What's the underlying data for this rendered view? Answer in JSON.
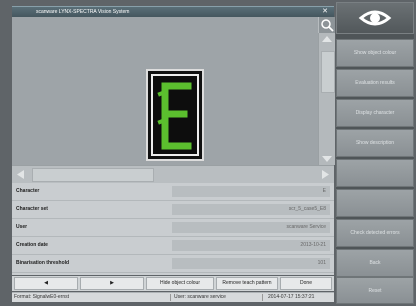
{
  "window": {
    "title": "scanware LYNX-SPECTRA Vision System",
    "close_glyph": "✕"
  },
  "viewer": {
    "zoom_icon": "search-icon",
    "character_shown": "E",
    "character_color": "#5bbf2e"
  },
  "info": {
    "rows": [
      {
        "label": "Character",
        "value": "E"
      },
      {
        "label": "Character set",
        "value": "scr_5_case5_E8"
      },
      {
        "label": "User",
        "value": "scanware Service"
      },
      {
        "label": "Creation date",
        "value": "2013-10-21"
      },
      {
        "label": "Binarisation threshold",
        "value": "101"
      }
    ]
  },
  "buttons": {
    "prev": "◀",
    "next": "▶",
    "hide": "Hide object colour",
    "remove": "Remove teach pattern",
    "done": "Done"
  },
  "status": {
    "format": "Format: SignalwE0-ernst",
    "user": "User: scanware service",
    "datetime": "2014-07-17 15:37:21"
  },
  "side": {
    "eye_icon": "eye-icon",
    "items": [
      {
        "label": "Show object colour"
      },
      {
        "label": "Evaluation results"
      },
      {
        "label": "Display character"
      },
      {
        "label": "Show description"
      },
      {
        "label": ""
      },
      {
        "label": ""
      },
      {
        "label": "Check detected errors"
      },
      {
        "label": "Back"
      },
      {
        "label": "Reset"
      }
    ]
  }
}
